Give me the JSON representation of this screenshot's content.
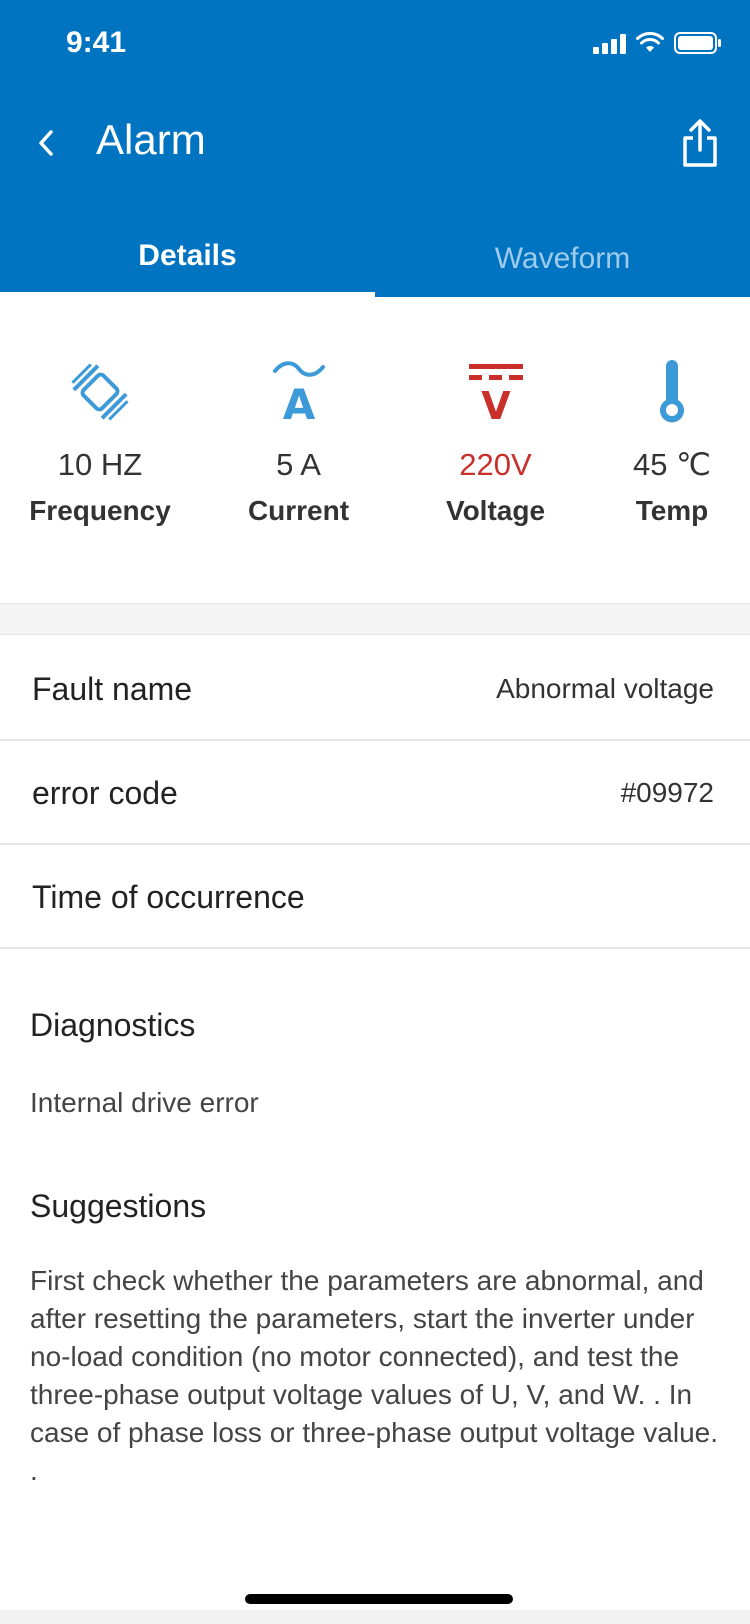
{
  "status_bar": {
    "time": "9:41"
  },
  "header": {
    "title": "Alarm"
  },
  "tabs": [
    {
      "label": "Details",
      "active": true
    },
    {
      "label": "Waveform",
      "active": false
    }
  ],
  "metrics": [
    {
      "value": "10 HZ",
      "label": "Frequency",
      "icon": "frequency-icon"
    },
    {
      "value": "5 A",
      "label": "Current",
      "icon": "current-icon"
    },
    {
      "value": "220V",
      "label": "Voltage",
      "icon": "voltage-icon",
      "alert": true
    },
    {
      "value": "45 ℃",
      "label": "Temp",
      "icon": "thermometer-icon"
    }
  ],
  "details": {
    "fault_name": {
      "label": "Fault name",
      "value": "Abnormal voltage"
    },
    "error_code": {
      "label": "error code",
      "value": "#09972"
    },
    "time_of_occurrence": {
      "label": "Time of occurrence",
      "value": ""
    }
  },
  "diagnostics": {
    "title": "Diagnostics",
    "text": "Internal drive error"
  },
  "suggestions": {
    "title": "Suggestions",
    "text": "First check whether the parameters are abnormal, and after resetting the parameters, start the inverter under no-load condition (no motor connected), and test the three-phase output voltage values of U, V, and W. . In case of phase loss or three-phase output voltage value. ."
  },
  "colors": {
    "primary": "#0074c1",
    "icon_blue": "#3d9ad8",
    "alert_red": "#c9302c"
  }
}
